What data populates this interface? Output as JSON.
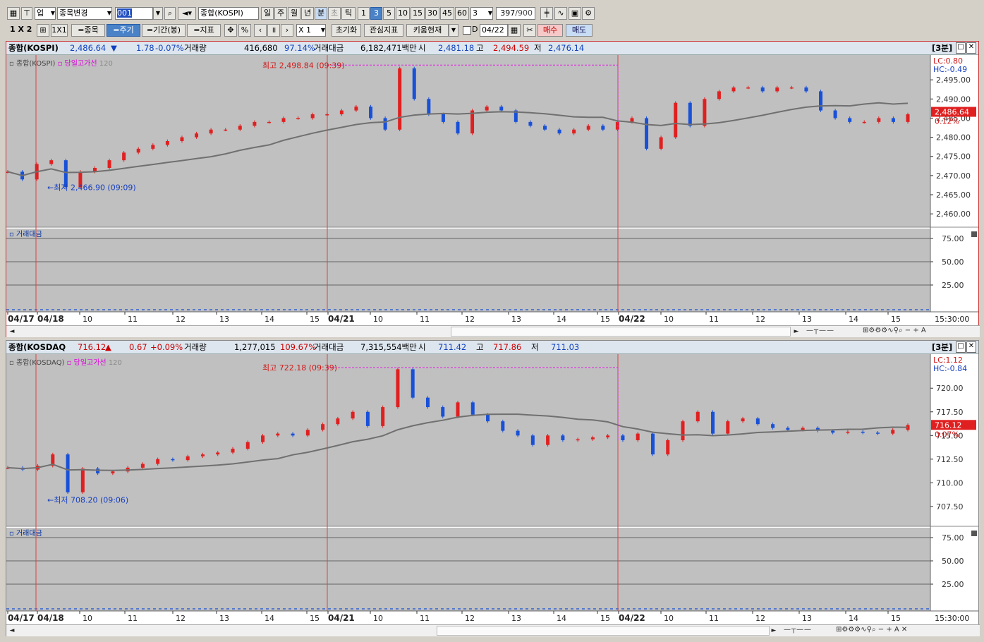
{
  "toolbar1": {
    "market_select": "업",
    "stock_change": "종목변경",
    "code": "001",
    "stock_name": "종합(KOSPI)",
    "periods": [
      "일",
      "주",
      "월",
      "년",
      "분",
      "초",
      "틱"
    ],
    "selected_period": "분",
    "minutes": [
      "1",
      "3",
      "5",
      "10",
      "15",
      "30",
      "45",
      "60"
    ],
    "selected_minute": "3",
    "custom_minute": "3",
    "count": "397",
    "count_total": "/900"
  },
  "toolbar2": {
    "layout": "1 X 2",
    "ratio": "1X1",
    "same_stock": "=종목",
    "same_period": "=주기",
    "same_range": "=기간(봉)",
    "same_indicator": "=지표",
    "pct": "%",
    "zoom": "X 1",
    "reset": "초기화",
    "favorites": "관심지표",
    "kiwoom": "키움현재",
    "date_label": "D",
    "date": "04/22",
    "buy": "매수",
    "sell": "매도"
  },
  "panel1": {
    "name": "종합(KOSPI)",
    "price": "2,486.64",
    "change_sign": "▼",
    "change": "1.78",
    "pct": "-0.07%",
    "vol_label": "거래량",
    "volume": "416,680",
    "vol_ratio": "97.14%",
    "amount_label": "거래대금",
    "amount": "6,182,471백만",
    "open_label": "시",
    "open": "2,481.18",
    "high_label": "고",
    "high": "2,494.59",
    "low_label": "저",
    "low": "2,476.14",
    "interval": "[3분]",
    "legend_main": "종합(KOSPI)",
    "legend_high": "당일고가선",
    "legend_ma": "120",
    "lc": "LC:0.80",
    "hc": "HC:-0.49",
    "price_tag": "2,486.64",
    "pct_tag": "0.12%",
    "max_label": "최고 2,498.84 (09:39)",
    "min_label": "최저 2,466.90 (09:09)",
    "yticks": [
      "2,495.00",
      "2,490.00",
      "2,485.00",
      "2,480.00",
      "2,475.00",
      "2,470.00",
      "2,465.00",
      "2,460.00"
    ],
    "sub_title": "거래대금",
    "sub_ticks": [
      "75.00",
      "50.00",
      "25.00"
    ],
    "time_label": "15:30:00"
  },
  "panel2": {
    "name": "종합(KOSDAQ",
    "price": "716.12",
    "change_sign": "▲",
    "change": "0.67",
    "pct": "+0.09%",
    "vol_label": "거래량",
    "volume": "1,277,015",
    "vol_ratio": "109.67%",
    "amount_label": "거래대금",
    "amount": "7,315,554백만",
    "open_label": "시",
    "open": "711.42",
    "high_label": "고",
    "high": "717.86",
    "low_label": "저",
    "low": "711.03",
    "interval": "[3분]",
    "legend_main": "종합(KOSDAQ)",
    "legend_high": "당일고가선",
    "legend_ma": "120",
    "lc": "LC:1.12",
    "hc": "HC:-0.84",
    "price_tag": "716.12",
    "pct_tag": "0.07%",
    "max_label": "최고 722.18 (09:39)",
    "min_label": "최저 708.20 (09:06)",
    "yticks": [
      "720.00",
      "717.50",
      "715.00",
      "712.50",
      "710.00",
      "707.50"
    ],
    "sub_title": "거래대금",
    "sub_ticks": [
      "75.00",
      "50.00",
      "25.00"
    ],
    "time_label": "15:30:00"
  },
  "xaxis": {
    "labels": [
      "04/17",
      "04/18",
      "10",
      "11",
      "12",
      "13",
      "14",
      "15",
      "04/21",
      "10",
      "11",
      "12",
      "13",
      "14",
      "15",
      "04/22",
      "10",
      "11",
      "12",
      "13",
      "14",
      "15"
    ]
  },
  "chart_data": [
    {
      "type": "candlestick",
      "title": "종합(KOSPI) 3분",
      "ylim": [
        2458,
        2500
      ],
      "x": [
        "04/17",
        "04/18",
        "04/21",
        "04/22"
      ],
      "max": 2498.84,
      "min": 2466.9,
      "last": 2486.64,
      "close_path": [
        2471,
        2469,
        2473,
        2474,
        2467,
        2471,
        2472,
        2474,
        2476,
        2477,
        2478,
        2479,
        2480,
        2481,
        2482,
        2482,
        2483,
        2484,
        2484,
        2485,
        2485,
        2486,
        2486,
        2487,
        2488,
        2485,
        2482,
        2498,
        2490,
        2486,
        2484,
        2481,
        2487,
        2488,
        2487,
        2484,
        2483,
        2482,
        2481,
        2482,
        2483,
        2482,
        2484,
        2485,
        2477,
        2480,
        2489,
        2483,
        2490,
        2492,
        2493,
        2493,
        2492,
        2493,
        2493,
        2492,
        2487,
        2485,
        2484,
        2484,
        2485,
        2484,
        2486
      ]
    },
    {
      "type": "candlestick",
      "title": "종합(KOSDAQ) 3분",
      "ylim": [
        706,
        723
      ],
      "x": [
        "04/17",
        "04/18",
        "04/21",
        "04/22"
      ],
      "max": 722.18,
      "min": 708.2,
      "last": 716.12,
      "close_path": [
        711.6,
        711.4,
        711.8,
        713.0,
        709.0,
        711.5,
        711.0,
        711.2,
        711.6,
        712.0,
        712.5,
        712.4,
        712.8,
        713.0,
        713.2,
        713.6,
        714.3,
        715.0,
        715.2,
        715.0,
        715.6,
        716.2,
        716.8,
        717.5,
        716.0,
        718.0,
        722.0,
        719.0,
        718.0,
        717.0,
        718.5,
        717.2,
        716.5,
        715.5,
        715.0,
        714.0,
        715.0,
        714.5,
        714.6,
        714.8,
        715.0,
        714.5,
        715.2,
        713.0,
        714.5,
        716.5,
        717.5,
        715.2,
        716.5,
        716.8,
        716.2,
        715.8,
        715.6,
        715.8,
        715.5,
        715.3,
        715.4,
        715.3,
        715.2,
        715.6,
        716.1
      ]
    }
  ]
}
